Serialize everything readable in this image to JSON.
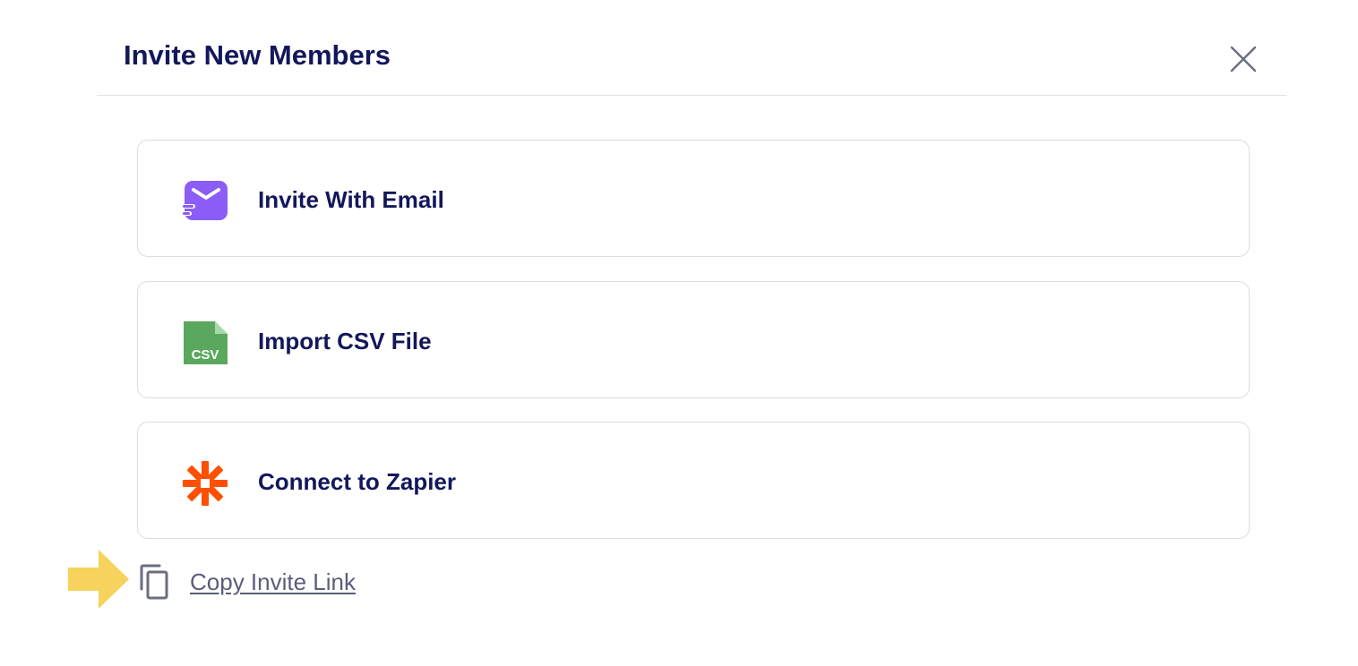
{
  "modal": {
    "title": "Invite New Members",
    "close_icon": "close-icon"
  },
  "options": [
    {
      "label": "Invite With Email",
      "icon": "email-icon",
      "icon_color": "#8b5cf6"
    },
    {
      "label": "Import CSV File",
      "icon": "csv-file-icon",
      "icon_color": "#5aa85e",
      "icon_text": "CSV"
    },
    {
      "label": "Connect to Zapier",
      "icon": "zapier-icon",
      "icon_color": "#ff4f00"
    }
  ],
  "copy_link": {
    "label": "Copy Invite Link",
    "icon": "copy-icon"
  },
  "annotation": {
    "icon": "arrow-right-icon",
    "color": "#f5d35c"
  },
  "colors": {
    "text_primary": "#13175a",
    "border": "#dcdde3",
    "link": "#5a5e7a"
  }
}
